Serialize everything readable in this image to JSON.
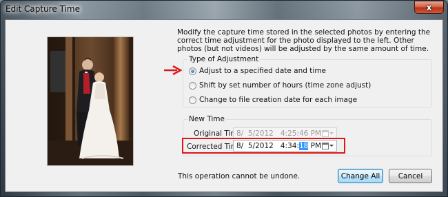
{
  "window": {
    "title": "Edit Capture Time",
    "close_glyph": "x"
  },
  "description": "Modify the capture time stored in the selected photos by entering the correct time adjustment for the photo displayed to the left. Other photos (but not videos) will be adjusted by the same amount of time.",
  "adjustment": {
    "legend": "Type of Adjustment",
    "options": [
      {
        "label": "Adjust to a specified date and time",
        "checked": true
      },
      {
        "label": "Shift by set number of hours (time zone adjust)",
        "checked": false
      },
      {
        "label": "Change to file creation date for each image",
        "checked": false
      }
    ]
  },
  "new_time": {
    "legend": "New Time",
    "original_label": "Original Time:",
    "original_value": "8/  5/2012   4:25:46 PM",
    "corrected_label": "Corrected Time:",
    "corrected_before": "8/  5/2012   4:34:",
    "corrected_selected": "18",
    "corrected_after": " PM"
  },
  "footer": {
    "note": "This operation cannot be undone.",
    "change_all_label": "Change All",
    "cancel_label": "Cancel"
  },
  "icons": {
    "close": "close-icon",
    "calendar": "calendar-dropdown-icon",
    "annotation_arrow": "red-arrow-icon"
  },
  "colors": {
    "annotation": "#e01414",
    "selection": "#3399ff",
    "close_button": "#c63a1c"
  }
}
